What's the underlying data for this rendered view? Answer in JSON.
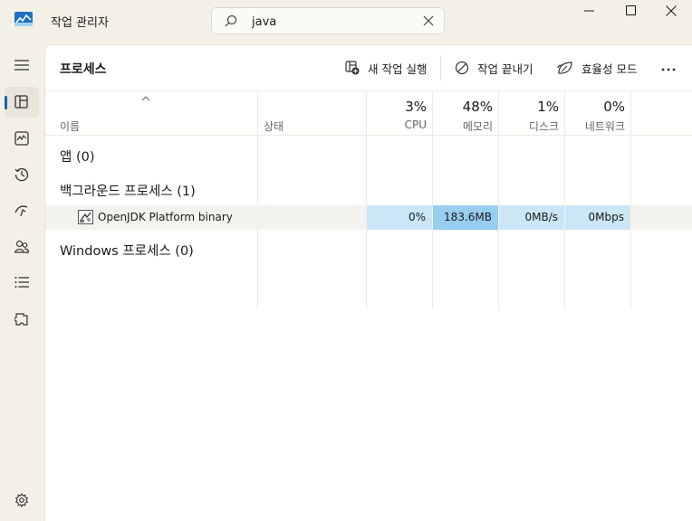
{
  "window": {
    "title": "작업 관리자",
    "search_value": "java",
    "minimize_icon": "minimize-icon",
    "maximize_icon": "maximize-icon",
    "close_icon": "close-icon"
  },
  "nav": {
    "items": [
      {
        "icon": "hamburger-menu-icon"
      },
      {
        "icon": "processes-icon",
        "active": true
      },
      {
        "icon": "performance-icon"
      },
      {
        "icon": "app-history-icon"
      },
      {
        "icon": "startup-apps-icon"
      },
      {
        "icon": "users-icon"
      },
      {
        "icon": "details-icon"
      },
      {
        "icon": "services-icon"
      },
      {
        "icon": "settings-icon"
      }
    ]
  },
  "toolbar": {
    "page_title": "프로세스",
    "new_task": "새 작업 실행",
    "end_task": "작업 끝내기",
    "efficiency_mode": "효율성 모드",
    "more_icon": "more-options-icon"
  },
  "table": {
    "headers": {
      "name": "이름",
      "status": "상태",
      "cpu_pct": "3%",
      "cpu_label": "CPU",
      "mem_pct": "48%",
      "mem_label": "메모리",
      "disk_pct": "1%",
      "disk_label": "디스크",
      "net_pct": "0%",
      "net_label": "네트워크"
    },
    "groups": {
      "apps": "앱 (0)",
      "background": "백그라운드 프로세스 (1)",
      "windows": "Windows 프로세스 (0)"
    },
    "process": {
      "name": "OpenJDK Platform binary",
      "cpu": "0%",
      "memory": "183.6MB",
      "disk": "0MB/s",
      "network": "0Mbps"
    }
  },
  "colors": {
    "accent": "#1063b0",
    "heat_low": "#cbe6f6",
    "heat_high": "#97cdef",
    "window_bg": "#f3f1e7"
  }
}
